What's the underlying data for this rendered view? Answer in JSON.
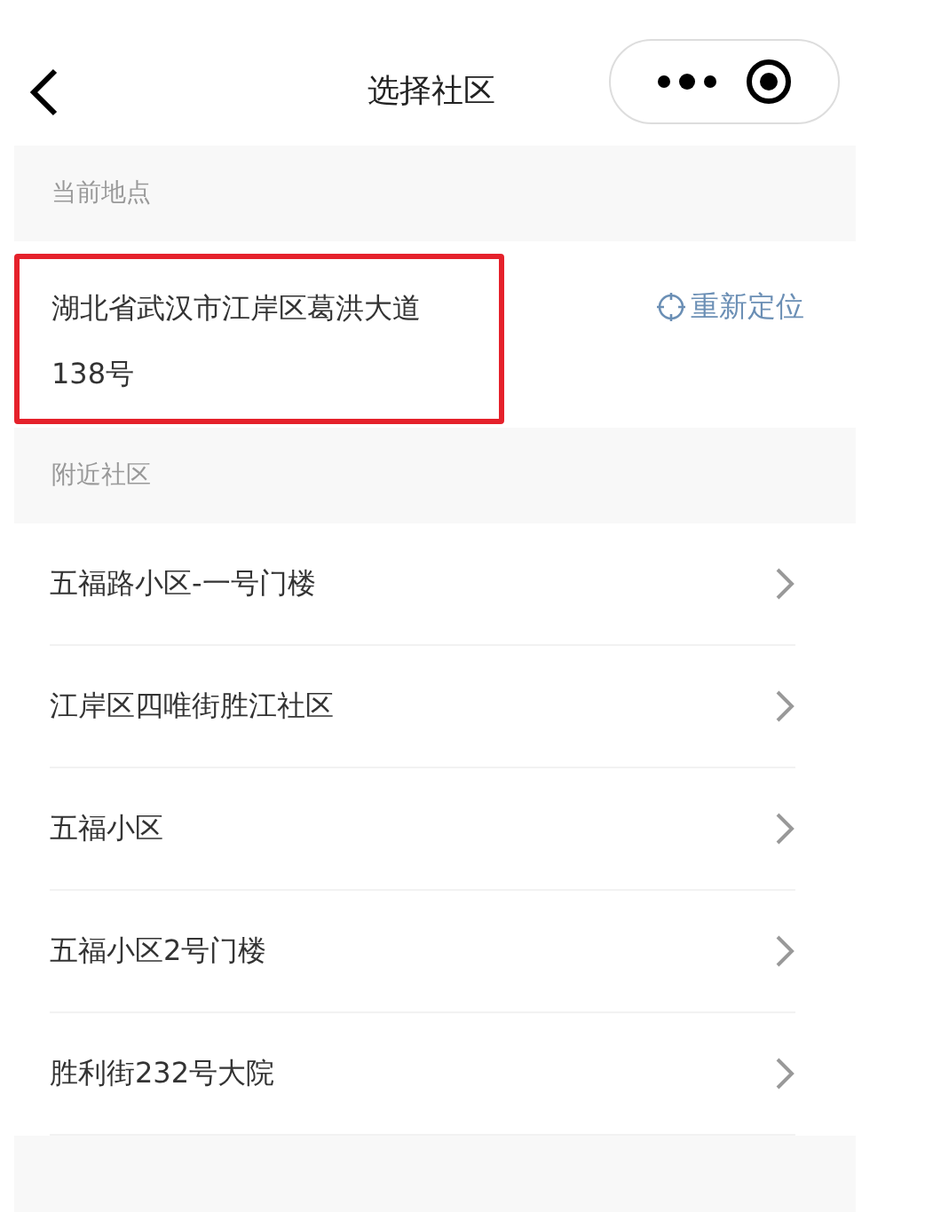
{
  "nav": {
    "title": "选择社区"
  },
  "current_section": {
    "header": "当前地点",
    "address": "湖北省武汉市江岸区葛洪大道138号",
    "relocate": "重新定位"
  },
  "nearby_section": {
    "header": "附近社区",
    "items": [
      {
        "label": "五福路小区-一号门楼"
      },
      {
        "label": "江岸区四唯街胜江社区"
      },
      {
        "label": "五福小区"
      },
      {
        "label": "五福小区2号门楼"
      },
      {
        "label": "胜利街232号大院"
      }
    ]
  }
}
